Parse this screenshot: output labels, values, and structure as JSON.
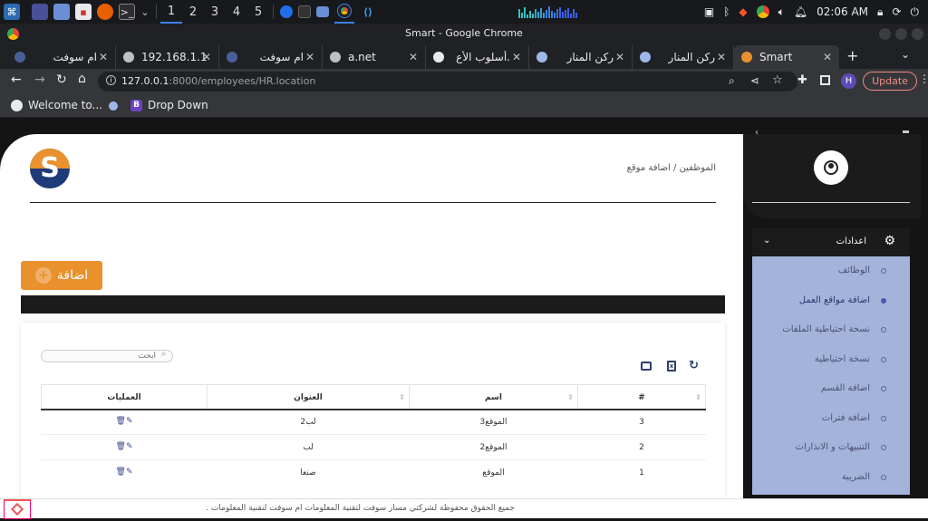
{
  "taskbar": {
    "workspaces": [
      "1",
      "2",
      "3",
      "4",
      "5"
    ],
    "clock": "02:06 AM"
  },
  "window": {
    "title": "Smart - Google Chrome"
  },
  "tabs": [
    {
      "label": "ام سوفت"
    },
    {
      "label": "192.168.1.1"
    },
    {
      "label": "ام سوفت"
    },
    {
      "label": "a.net"
    },
    {
      "label": "أسلوب الأع."
    },
    {
      "label": "ركن المنار"
    },
    {
      "label": "ركن المنار"
    },
    {
      "label": "Smart"
    }
  ],
  "toolbar": {
    "url_host": "127.0.0.1",
    "url_path": ":8000/employees/HR.location",
    "profile_initial": "H",
    "update_label": "Update"
  },
  "bookmarks": [
    {
      "label": "Welcome to..."
    },
    {
      "label": "Drop Down"
    }
  ],
  "header": {
    "breadcrumb": "الموظفين / اضافة موقع"
  },
  "add_button": {
    "label": "اضافة",
    "icon": "+"
  },
  "search": {
    "placeholder": "ابحث"
  },
  "table": {
    "columns": [
      "#",
      "اسم",
      "العنوان",
      "العمليات"
    ],
    "rows": [
      {
        "num": "3",
        "name": "الموقع3",
        "address": "لب2"
      },
      {
        "num": "2",
        "name": "الموقع2",
        "address": "لب"
      },
      {
        "num": "1",
        "name": "الموقع",
        "address": "صنعا"
      }
    ]
  },
  "sidebar": {
    "settings_label": "اعدادات",
    "items": [
      {
        "label": "الوظائف",
        "active": false
      },
      {
        "label": "اضافة مواقع العمل",
        "active": true
      },
      {
        "label": "نسخة احتياطية الملفات",
        "active": false
      },
      {
        "label": "نسخة احتياطية",
        "active": false
      },
      {
        "label": "اضافة القسم",
        "active": false
      },
      {
        "label": "اضافة فترات",
        "active": false
      },
      {
        "label": "التنبيهات و الانذارات",
        "active": false
      },
      {
        "label": "الضريبة",
        "active": false
      }
    ]
  },
  "footer": {
    "text": "جميع الحقوق محفوظة لشركتي مسار سوفت لتقنية المعلومات ام سوفت لتقنية المعلومات ."
  },
  "colors": {
    "accent": "#e8912d",
    "sidebar": "#a3b3d9",
    "dark": "#1b1b1b"
  }
}
